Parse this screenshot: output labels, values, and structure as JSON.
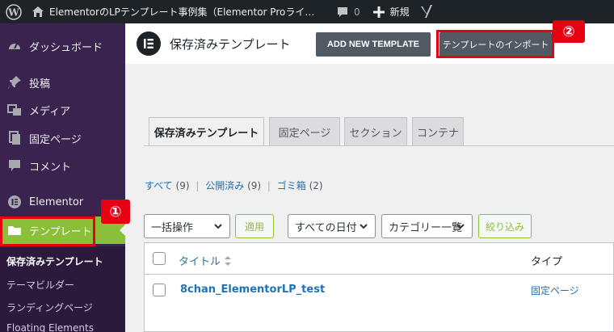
{
  "adminbar": {
    "site_title": "ElementorのLPテンプレート事例集（Elementor Proライセンス...",
    "comments_count": "0",
    "new_label": "新規"
  },
  "sidebar": {
    "items": [
      {
        "label": "ダッシュボード",
        "icon": "dashboard-icon"
      },
      {
        "label": "投稿",
        "icon": "pin-icon"
      },
      {
        "label": "メディア",
        "icon": "media-icon"
      },
      {
        "label": "固定ページ",
        "icon": "page-icon"
      },
      {
        "label": "コメント",
        "icon": "comment-icon"
      },
      {
        "label": "Elementor",
        "icon": "elementor-icon"
      },
      {
        "label": "テンプレート",
        "icon": "folder-icon"
      }
    ],
    "submenu": [
      "保存済みテンプレート",
      "テーマビルダー",
      "ランディングページ",
      "Floating Elements"
    ]
  },
  "annotations": {
    "one": "①",
    "two": "②"
  },
  "header": {
    "title": "保存済みテンプレート",
    "add_new": "ADD NEW TEMPLATE",
    "import": "テンプレートのインポート"
  },
  "tabs": [
    "保存済みテンプレート",
    "固定ページ",
    "セクション",
    "コンテナ"
  ],
  "subsub": {
    "all": "すべて",
    "all_count": "(9)",
    "published": "公開済み",
    "published_count": "(9)",
    "trash": "ゴミ箱",
    "trash_count": "(2)"
  },
  "filters": {
    "bulk": "一括操作",
    "apply": "適用",
    "dates": "すべての日付",
    "categories": "カテゴリー一覧",
    "filter": "絞り込み"
  },
  "table": {
    "col_title": "タイトル",
    "col_type": "タイプ",
    "rows": [
      {
        "title": "8chan_ElementorLP_test",
        "type": "固定ページ"
      }
    ]
  },
  "colors": {
    "accent": "#8bbf37",
    "annotation": "#e60012",
    "sidebar": "#3b2350"
  }
}
